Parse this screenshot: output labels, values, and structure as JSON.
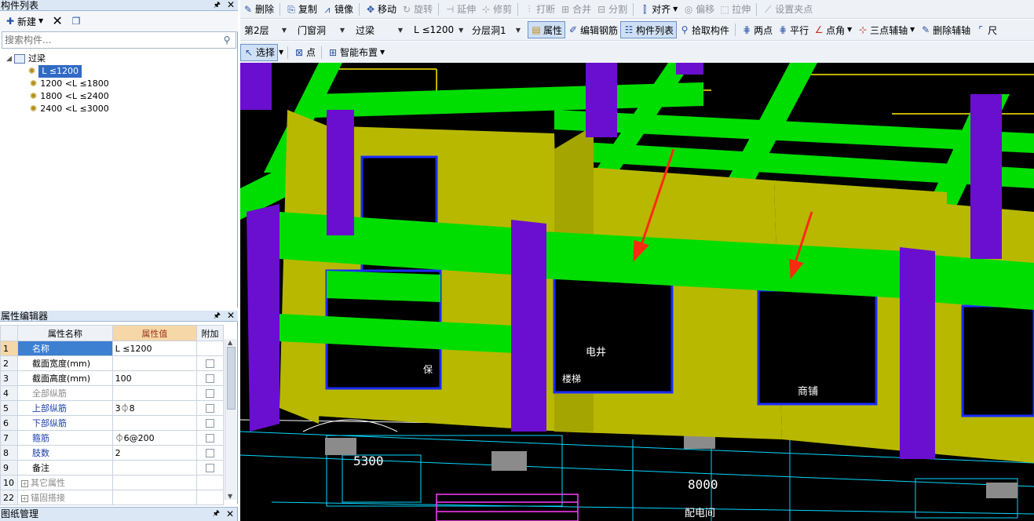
{
  "component_panel": {
    "title": "构件列表",
    "new_label": "新建",
    "search_placeholder": "搜索构件...",
    "tree": {
      "root": "过梁",
      "items": [
        "L ≤1200",
        "1200 <L ≤1800",
        "1800 <L ≤2400",
        "2400 <L ≤3000"
      ]
    }
  },
  "property_panel": {
    "title": "属性编辑器",
    "columns": [
      "属性名称",
      "属性值",
      "附加"
    ],
    "rows": [
      {
        "num": "1",
        "name": "名称",
        "value": "L ≤1200"
      },
      {
        "num": "2",
        "name": "截面宽度(mm)",
        "value": ""
      },
      {
        "num": "3",
        "name": "截面高度(mm)",
        "value": "100"
      },
      {
        "num": "4",
        "name": "全部纵筋",
        "value": ""
      },
      {
        "num": "5",
        "name": "上部纵筋",
        "value": "3⏀8"
      },
      {
        "num": "6",
        "name": "下部纵筋",
        "value": ""
      },
      {
        "num": "7",
        "name": "箍筋",
        "value": "⏀6@200"
      },
      {
        "num": "8",
        "name": "肢数",
        "value": "2"
      },
      {
        "num": "9",
        "name": "备注",
        "value": ""
      },
      {
        "num": "10",
        "name": "其它属性",
        "value": ""
      },
      {
        "num": "22",
        "name": "锚固搭接",
        "value": ""
      }
    ]
  },
  "drawing_panel": {
    "title": "图纸管理"
  },
  "toolbar_edit": {
    "delete": "删除",
    "copy": "复制",
    "mirror": "镜像",
    "move": "移动",
    "rotate": "旋转",
    "extend": "延伸",
    "trim": "修剪",
    "break": "打断",
    "merge": "合并",
    "split": "分割",
    "align": "对齐",
    "offset": "偏移",
    "stretch": "拉伸",
    "set_grip": "设置夹点"
  },
  "toolbar_filter": {
    "floor": "第2层",
    "category": "门窗洞",
    "type": "过梁",
    "component": "L ≤1200",
    "sublayer": "分层洞1",
    "properties": "属性",
    "edit_rebar": "编辑钢筋",
    "component_list": "构件列表",
    "pick": "拾取构件",
    "two_points": "两点",
    "parallel": "平行",
    "point_angle": "点角",
    "three_point_axis": "三点辅轴",
    "delete_axis": "删除辅轴",
    "dimension": "尺"
  },
  "toolbar_draw": {
    "select": "选择",
    "point": "点",
    "smart_layout": "智能布置"
  },
  "viewport": {
    "dims": [
      "5300",
      "8000"
    ],
    "labels": [
      "电井",
      "楼梯",
      "商铺",
      "配电间",
      "保"
    ],
    "colors": {
      "beam": "#00dd00",
      "column": "#6a0fd0",
      "wall": "#b8b800",
      "arrow": "#ff2a12",
      "background": "#000000",
      "cad": "#00ffff"
    }
  }
}
